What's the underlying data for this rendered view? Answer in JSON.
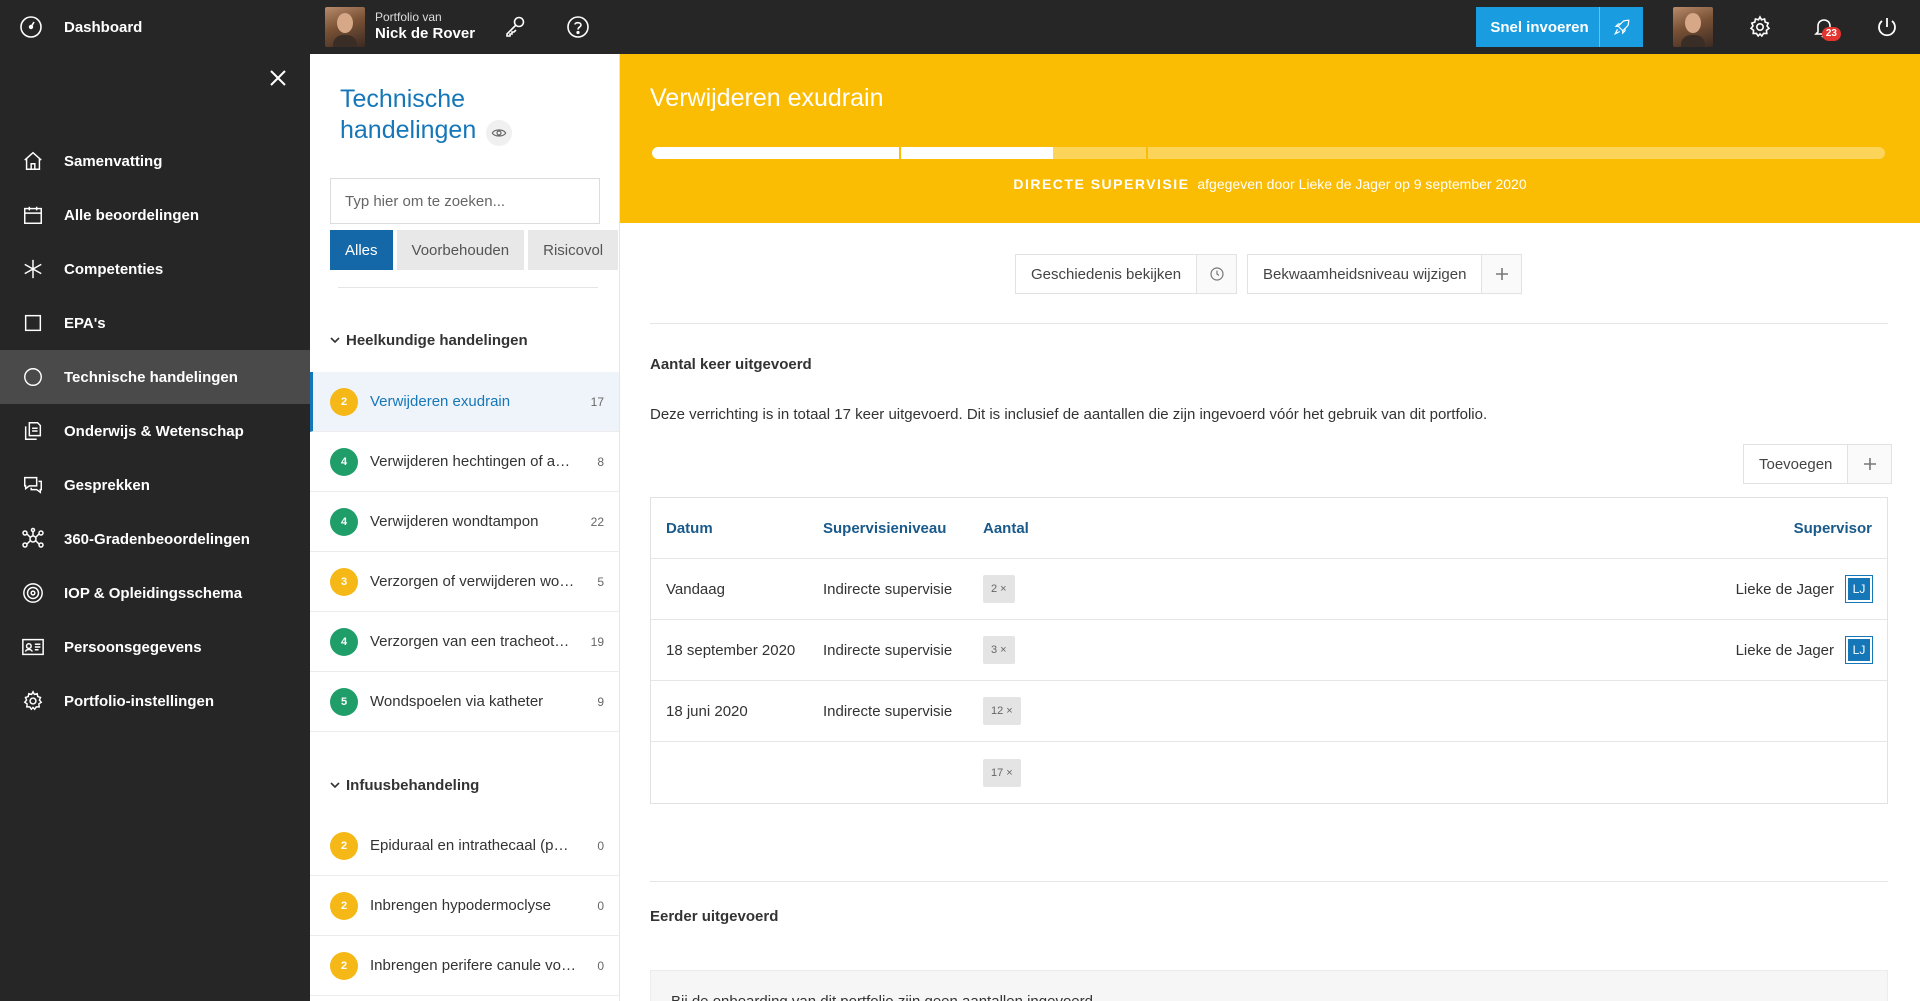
{
  "topbar": {
    "dashboard_label": "Dashboard",
    "portfolio_small": "Portfolio van",
    "portfolio_name": "Nick de Rover",
    "snel_label": "Snel invoeren",
    "notification_count": "23",
    "accent": "#1a9ce0"
  },
  "sidebar": {
    "items": [
      {
        "label": "Samenvatting",
        "icon": "home-icon"
      },
      {
        "label": "Alle beoordelingen",
        "icon": "calendar-icon"
      },
      {
        "label": "Competenties",
        "icon": "asterisk-icon"
      },
      {
        "label": "EPA's",
        "icon": "square-icon"
      },
      {
        "label": "Technische handelingen",
        "icon": "circle-icon"
      },
      {
        "label": "Onderwijs & Wetenschap",
        "icon": "documents-icon"
      },
      {
        "label": "Gesprekken",
        "icon": "chat-icon"
      },
      {
        "label": "360-Gradenbeoordelingen",
        "icon": "network-icon"
      },
      {
        "label": "IOP & Opleidingsschema",
        "icon": "target-icon"
      },
      {
        "label": "Persoonsgegevens",
        "icon": "id-card-icon"
      },
      {
        "label": "Portfolio-instellingen",
        "icon": "gear-icon"
      }
    ]
  },
  "list_panel": {
    "title": "Technische handelingen",
    "search_placeholder": "Typ hier om te zoeken...",
    "tabs": [
      "Alles",
      "Voorbehouden",
      "Risicovol"
    ],
    "groups": [
      {
        "label": "Heelkundige handelingen",
        "items": [
          {
            "level": "2",
            "name": "Verwijderen exudrain",
            "count": "17"
          },
          {
            "level": "4",
            "name": "Verwijderen hechtingen of agrafes",
            "count": "8"
          },
          {
            "level": "4",
            "name": "Verwijderen wondtampon",
            "count": "22"
          },
          {
            "level": "3",
            "name": "Verzorgen of verwijderen wonddrain",
            "count": "5"
          },
          {
            "level": "4",
            "name": "Verzorgen van een tracheotomie",
            "count": "19"
          },
          {
            "level": "5",
            "name": "Wondspoelen via katheter",
            "count": "9"
          }
        ]
      },
      {
        "label": "Infuusbehandeling",
        "items": [
          {
            "level": "2",
            "name": "Epiduraal en intrathecaal (pomp)",
            "count": "0"
          },
          {
            "level": "2",
            "name": "Inbrengen hypodermoclyse",
            "count": "0"
          },
          {
            "level": "2",
            "name": "Inbrengen perifere canule voor infuus",
            "count": "0"
          }
        ]
      }
    ]
  },
  "detail": {
    "title": "Verwijderen exudrain",
    "progress_fraction": 0.325,
    "supervision_strong": "DIRECTE SUPERVISIE",
    "supervision_rest": "afgegeven door Lieke de Jager op 9 september 2020",
    "banner_color": "#fbbc04",
    "history_button": "Geschiedenis bekijken",
    "level_button": "Bekwaamheidsniveau wijzigen",
    "count_heading": "Aantal keer uitgevoerd",
    "count_desc": "Deze verrichting is in totaal 17 keer uitgevoerd. Dit is inclusief de aantallen die zijn ingevoerd vóór het gebruik van dit portfolio.",
    "add_button": "Toevoegen",
    "table": {
      "headers": [
        "Datum",
        "Supervisieniveau",
        "Aantal",
        "Supervisor"
      ],
      "rows": [
        {
          "date": "Vandaag",
          "level": "Indirecte supervisie",
          "count": "2 ×",
          "supervisor": "Lieke de Jager",
          "initials": "LJ"
        },
        {
          "date": "18 september 2020",
          "level": "Indirecte supervisie",
          "count": "3 ×",
          "supervisor": "Lieke de Jager",
          "initials": "LJ"
        },
        {
          "date": "18 juni 2020",
          "level": "Indirecte supervisie",
          "count": "12 ×",
          "supervisor": "",
          "initials": ""
        },
        {
          "date": "",
          "level": "",
          "count": "17 ×",
          "supervisor": "",
          "initials": ""
        }
      ]
    },
    "earlier_heading": "Eerder uitgevoerd",
    "earlier_note": "Bij de onboarding van dit portfolio zijn geen aantallen ingevoerd."
  }
}
